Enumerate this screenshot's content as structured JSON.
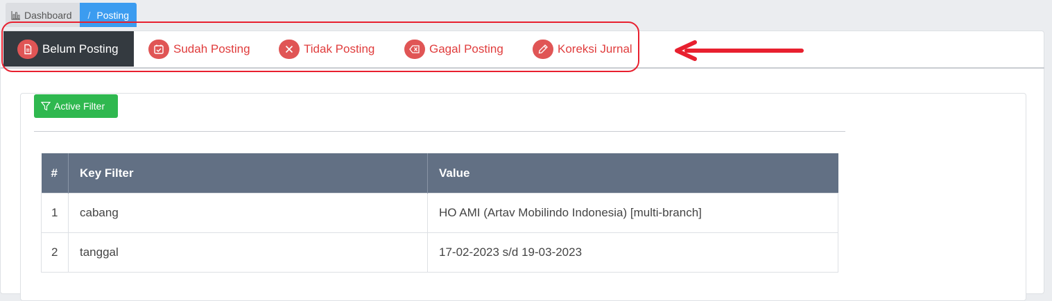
{
  "breadcrumb": {
    "dashboard": "Dashboard",
    "separator": "/",
    "current": "Posting"
  },
  "tabs": [
    {
      "label": "Belum Posting",
      "icon": "document-icon",
      "active": true
    },
    {
      "label": "Sudah Posting",
      "icon": "calendar-check-icon",
      "active": false
    },
    {
      "label": "Tidak Posting",
      "icon": "x-circle-icon",
      "active": false
    },
    {
      "label": "Gagal Posting",
      "icon": "backspace-icon",
      "active": false
    },
    {
      "label": "Koreksi Jurnal",
      "icon": "pen-icon",
      "active": false
    }
  ],
  "filter": {
    "button_label": "Active Filter"
  },
  "table": {
    "headers": [
      "#",
      "Key Filter",
      "Value"
    ],
    "rows": [
      {
        "num": "1",
        "key": "cabang",
        "value": "HO AMI (Artav Mobilindo Indonesia) [multi-branch]"
      },
      {
        "num": "2",
        "key": "tanggal",
        "value": "17-02-2023 s/d 19-03-2023"
      }
    ]
  },
  "colors": {
    "tab_text": "#e03c3c",
    "tab_active_bg": "#343a40",
    "header_bg": "#627084",
    "filter_button": "#2fb84f",
    "breadcrumb_active": "#3b9cf0"
  }
}
